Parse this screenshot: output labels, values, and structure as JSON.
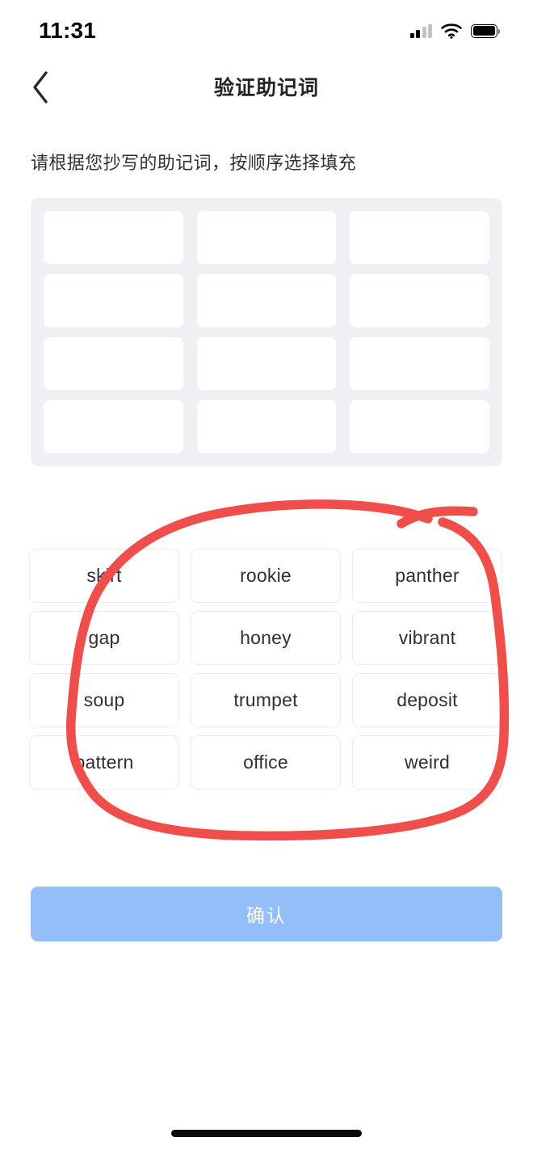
{
  "status_bar": {
    "time": "11:31",
    "signal_icon": "cellular-signal-icon",
    "wifi_icon": "wifi-icon",
    "battery_icon": "battery-full-icon"
  },
  "nav": {
    "back_icon": "chevron-left-icon",
    "title": "验证助记词"
  },
  "instruction": "请根据您抄写的助记词，按顺序选择填充",
  "answer_slots": {
    "count": 12,
    "values": [
      "",
      "",
      "",
      "",
      "",
      "",
      "",
      "",
      "",
      "",
      "",
      ""
    ]
  },
  "word_bank": {
    "words": [
      "skirt",
      "rookie",
      "panther",
      "gap",
      "honey",
      "vibrant",
      "soup",
      "trumpet",
      "deposit",
      "pattern",
      "office",
      "weird"
    ]
  },
  "confirm": {
    "label": "确认"
  },
  "annotation": {
    "type": "hand-drawn-lasso",
    "color": "#ef4e4b",
    "target": "word-bank"
  },
  "colors": {
    "accent_button": "#93befa",
    "slot_panel_bg": "#eef0f4",
    "chip_border": "#ececee",
    "text_primary": "#2f3034",
    "annotation_red": "#ef4e4b"
  }
}
